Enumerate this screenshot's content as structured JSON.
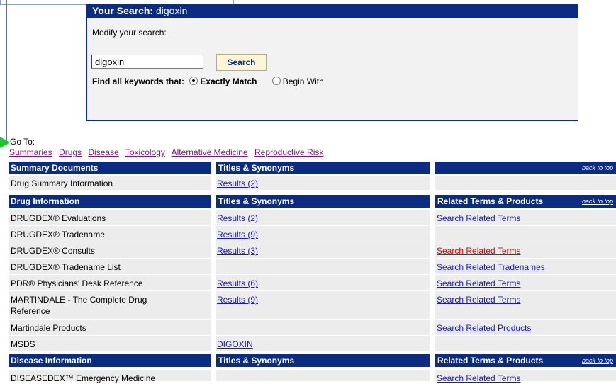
{
  "search": {
    "header_label": "Your Search:",
    "header_query": "digoxin",
    "modify_label": "Modify your search:",
    "input_value": "digoxin",
    "button_label": "Search",
    "find_label": "Find all keywords that:",
    "option_exact": "Exactly Match",
    "option_begin": "Begin With"
  },
  "goto": {
    "label": "Go To:",
    "links": [
      "Summaries",
      "Drugs",
      "Disease",
      "Toxicology",
      "Alternative Medicine",
      "Reproductive Risk"
    ]
  },
  "sections": {
    "summary": {
      "col1": "Summary Documents",
      "col2": "Titles & Synonyms",
      "col3": "",
      "back": "back to top",
      "rows": [
        {
          "name": "Drug Summary Information",
          "result": "Results (2)",
          "related": ""
        }
      ]
    },
    "drug": {
      "col1": "Drug Information",
      "col2": "Titles & Synonyms",
      "col3": "Related Terms & Products",
      "back": "back to top",
      "rows": [
        {
          "name": "DRUGDEX® Evaluations",
          "result": "Results (2)",
          "related": "Search Related Terms"
        },
        {
          "name": "DRUGDEX® Tradename",
          "result": "Results (9)",
          "related": ""
        },
        {
          "name": "DRUGDEX® Consults",
          "result": "Results (3)",
          "related": "Search Related Terms"
        },
        {
          "name": "DRUGDEX® Tradename List",
          "result": "",
          "related": "Search Related Tradenames"
        },
        {
          "name": "PDR® Physicians' Desk Reference",
          "result": "Results (6)",
          "related": "Search Related Terms"
        },
        {
          "name": "MARTINDALE - The Complete Drug Reference",
          "result": "Results (9)",
          "related": "Search Related Terms"
        },
        {
          "name": "Martindale Products",
          "result": "",
          "related": "Search Related Products"
        },
        {
          "name": "MSDS",
          "result": "DIGOXIN",
          "related": ""
        }
      ]
    },
    "disease": {
      "col1": "Disease Information",
      "col2": "Titles & Synonyms",
      "col3": "Related Terms & Products",
      "back": "back to top",
      "rows": [
        {
          "name": "DISEASEDEX™ Emergency Medicine",
          "result": "",
          "related": "Search Related Terms"
        }
      ]
    }
  },
  "colors": {
    "header_bg": "#0b2c80",
    "link": "#1a1ab8",
    "visited_link": "#7b1a7b",
    "active_link": "#e00000",
    "row_bg": "#ececec",
    "button_bg": "#fbf7d6"
  }
}
